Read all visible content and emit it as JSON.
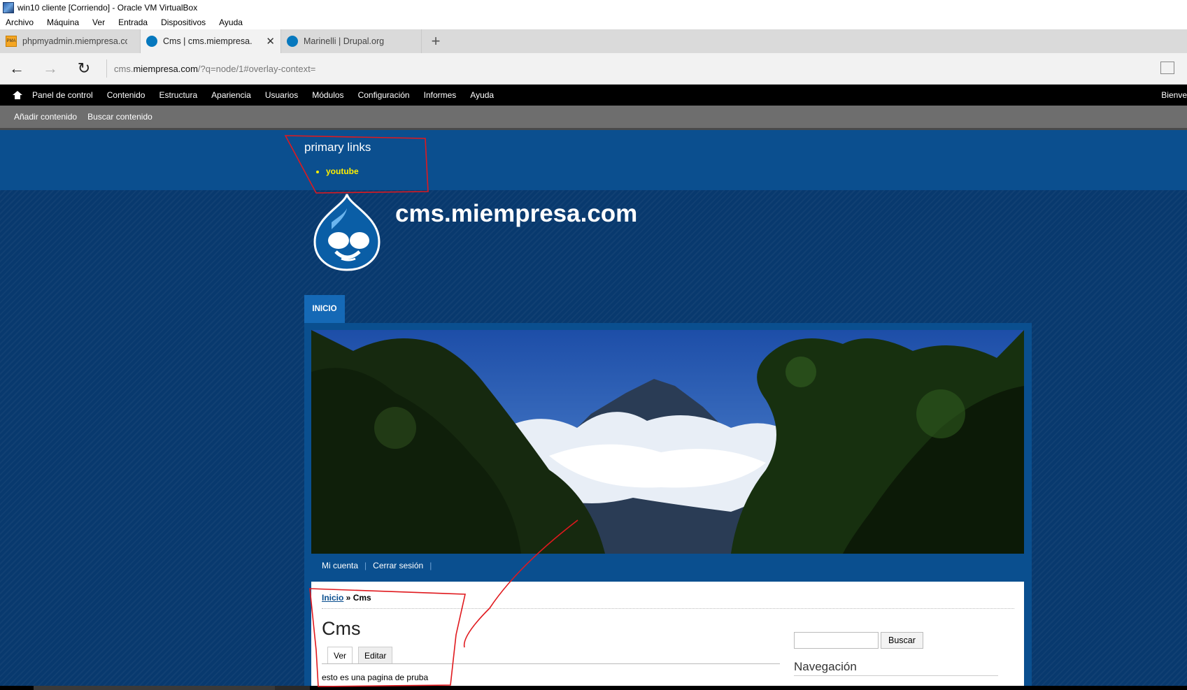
{
  "window": {
    "title": "win10 cliente [Corriendo] - Oracle VM VirtualBox"
  },
  "vbox_menu": [
    "Archivo",
    "Máquina",
    "Ver",
    "Entrada",
    "Dispositivos",
    "Ayuda"
  ],
  "browser": {
    "tabs": [
      {
        "label": "phpmyadmin.miempresa.cor",
        "icon": "phpmyadmin-icon",
        "active": false
      },
      {
        "label": "Cms | cms.miempresa.cc",
        "icon": "drupal-icon",
        "active": true
      },
      {
        "label": "Marinelli | Drupal.org",
        "icon": "drupal-icon",
        "active": false
      }
    ],
    "new_tab": "+",
    "close_tab": "✕",
    "address": {
      "prefix": "cms.",
      "domain": "miempresa.com",
      "suffix": "/?q=node/1#overlay-context="
    },
    "nav": {
      "back": "←",
      "forward": "→",
      "refresh": "↻"
    }
  },
  "drupal_toolbar": {
    "items": [
      "Panel de control",
      "Contenido",
      "Estructura",
      "Apariencia",
      "Usuarios",
      "Módulos",
      "Configuración",
      "Informes",
      "Ayuda"
    ],
    "right": "Bienve",
    "shortcuts": [
      "Añadir contenido",
      "Buscar contenido"
    ]
  },
  "site": {
    "primary_links_title": "primary links",
    "primary_links": [
      "youtube"
    ],
    "site_name": "cms.miempresa.com",
    "main_tab": "INICIO",
    "secondary_links": [
      "Mi cuenta",
      "Cerrar sesión"
    ],
    "secondary_sep": "|",
    "breadcrumb": {
      "home": "Inicio",
      "sep": " » ",
      "current": "Cms"
    },
    "page_title": "Cms",
    "local_tabs": [
      "Ver",
      "Editar"
    ],
    "body": "esto es una pagina de pruba",
    "search_button": "Buscar",
    "navigation_title": "Navegación"
  },
  "colors": {
    "site_bg": "#08396e",
    "header_band": "#0b4f8f",
    "primary_link": "#ffef00",
    "annotation": "#e0191e"
  }
}
